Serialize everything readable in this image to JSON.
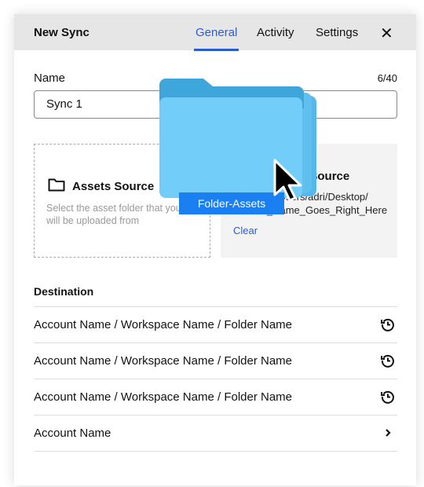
{
  "header": {
    "title": "New Sync",
    "tabs": [
      {
        "label": "General",
        "active": true
      },
      {
        "label": "Activity"
      },
      {
        "label": "Settings"
      }
    ],
    "close_icon": "close-icon"
  },
  "name": {
    "label": "Name",
    "counter": "6/40",
    "value": "Sync 1"
  },
  "assets_source": {
    "title": "Assets Source",
    "hint": "Select the asset folder that your files will be uploaded from"
  },
  "selected_source": {
    "title": "Assets Source",
    "path_line1": "/Users/adri/Desktop/",
    "path_line2": "Folder_Name_Goes_Right_Here",
    "clear": "Clear"
  },
  "destination": {
    "label": "Destination",
    "rows": [
      {
        "text": "Account Name / Workspace Name / Folder Name",
        "icon": "history-icon"
      },
      {
        "text": "Account Name / Workspace Name / Folder Name",
        "icon": "history-icon"
      },
      {
        "text": "Account Name / Workspace Name / Folder Name",
        "icon": "history-icon"
      },
      {
        "text": "Account Name",
        "icon": "chevron-right-icon"
      }
    ]
  },
  "drag": {
    "label": "Folder-Assets"
  },
  "colors": {
    "accent": "#2a5bd7",
    "folder": "#6ccbf7",
    "drag_label": "#1a7ff0"
  }
}
